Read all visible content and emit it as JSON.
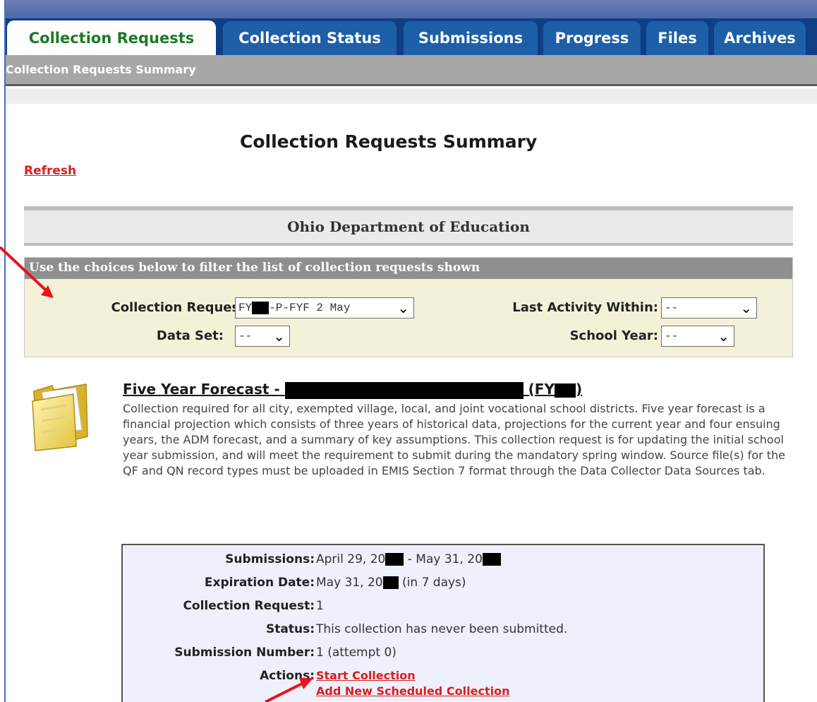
{
  "tabs": [
    {
      "label": "Collection Requests",
      "active": true
    },
    {
      "label": "Collection Status",
      "active": false
    },
    {
      "label": "Submissions",
      "active": false
    },
    {
      "label": "Progress",
      "active": false
    },
    {
      "label": "Files",
      "active": false
    },
    {
      "label": "Archives",
      "active": false
    }
  ],
  "breadcrumb": "Collection Requests Summary",
  "page_title": "Collection Requests Summary",
  "refresh_label": "Refresh",
  "org_name": "Ohio Department of Education",
  "filter": {
    "heading": "Use the choices below to filter the list of collection requests shown",
    "collection_request_label": "Collection Request:",
    "collection_request_value_prefix": "FY",
    "collection_request_value_suffix": "-P-FYF 2 May",
    "last_activity_label": "Last Activity Within:",
    "last_activity_value": "--",
    "data_set_label": "Data Set:",
    "data_set_value": "--",
    "school_year_label": "School Year:",
    "school_year_value": "--"
  },
  "item": {
    "title_prefix": "Five Year Forecast -",
    "title_fy_prefix": "(FY",
    "title_fy_suffix": ")",
    "description": "Collection required for all city, exempted village, local, and joint vocational school districts. Five year forecast is a financial projection which consists of three years of historical data, projections for the current year and four ensuing years, the ADM forecast, and a summary of key assumptions. This collection request is for updating the initial school year submission, and will meet the requirement to submit during the mandatory spring window. Source file(s) for the QF and QN record types must be uploaded in EMIS Section 7 format through the Data Collector Data Sources tab."
  },
  "details": {
    "submissions_label": "Submissions:",
    "submissions_start": "April 29, 20",
    "submissions_sep": " - May 31, 20",
    "expiration_label": "Expiration Date:",
    "expiration_value": "May 31, 20",
    "expiration_note": " (in 7 days)",
    "collection_request_label": "Collection Request:",
    "collection_request_value": "1",
    "status_label": "Status:",
    "status_value": "This collection has never been submitted.",
    "submission_number_label": "Submission Number:",
    "submission_number_value": "1 (attempt 0)",
    "actions_label": "Actions:",
    "actions": [
      "Start Collection",
      "Add New Scheduled Collection"
    ]
  },
  "colors": {
    "tab_blue": "#1d5fa8",
    "active_tab_text": "#1a7a25",
    "link_red": "#d81e1e",
    "annotation_arrow": "#e8141e"
  }
}
